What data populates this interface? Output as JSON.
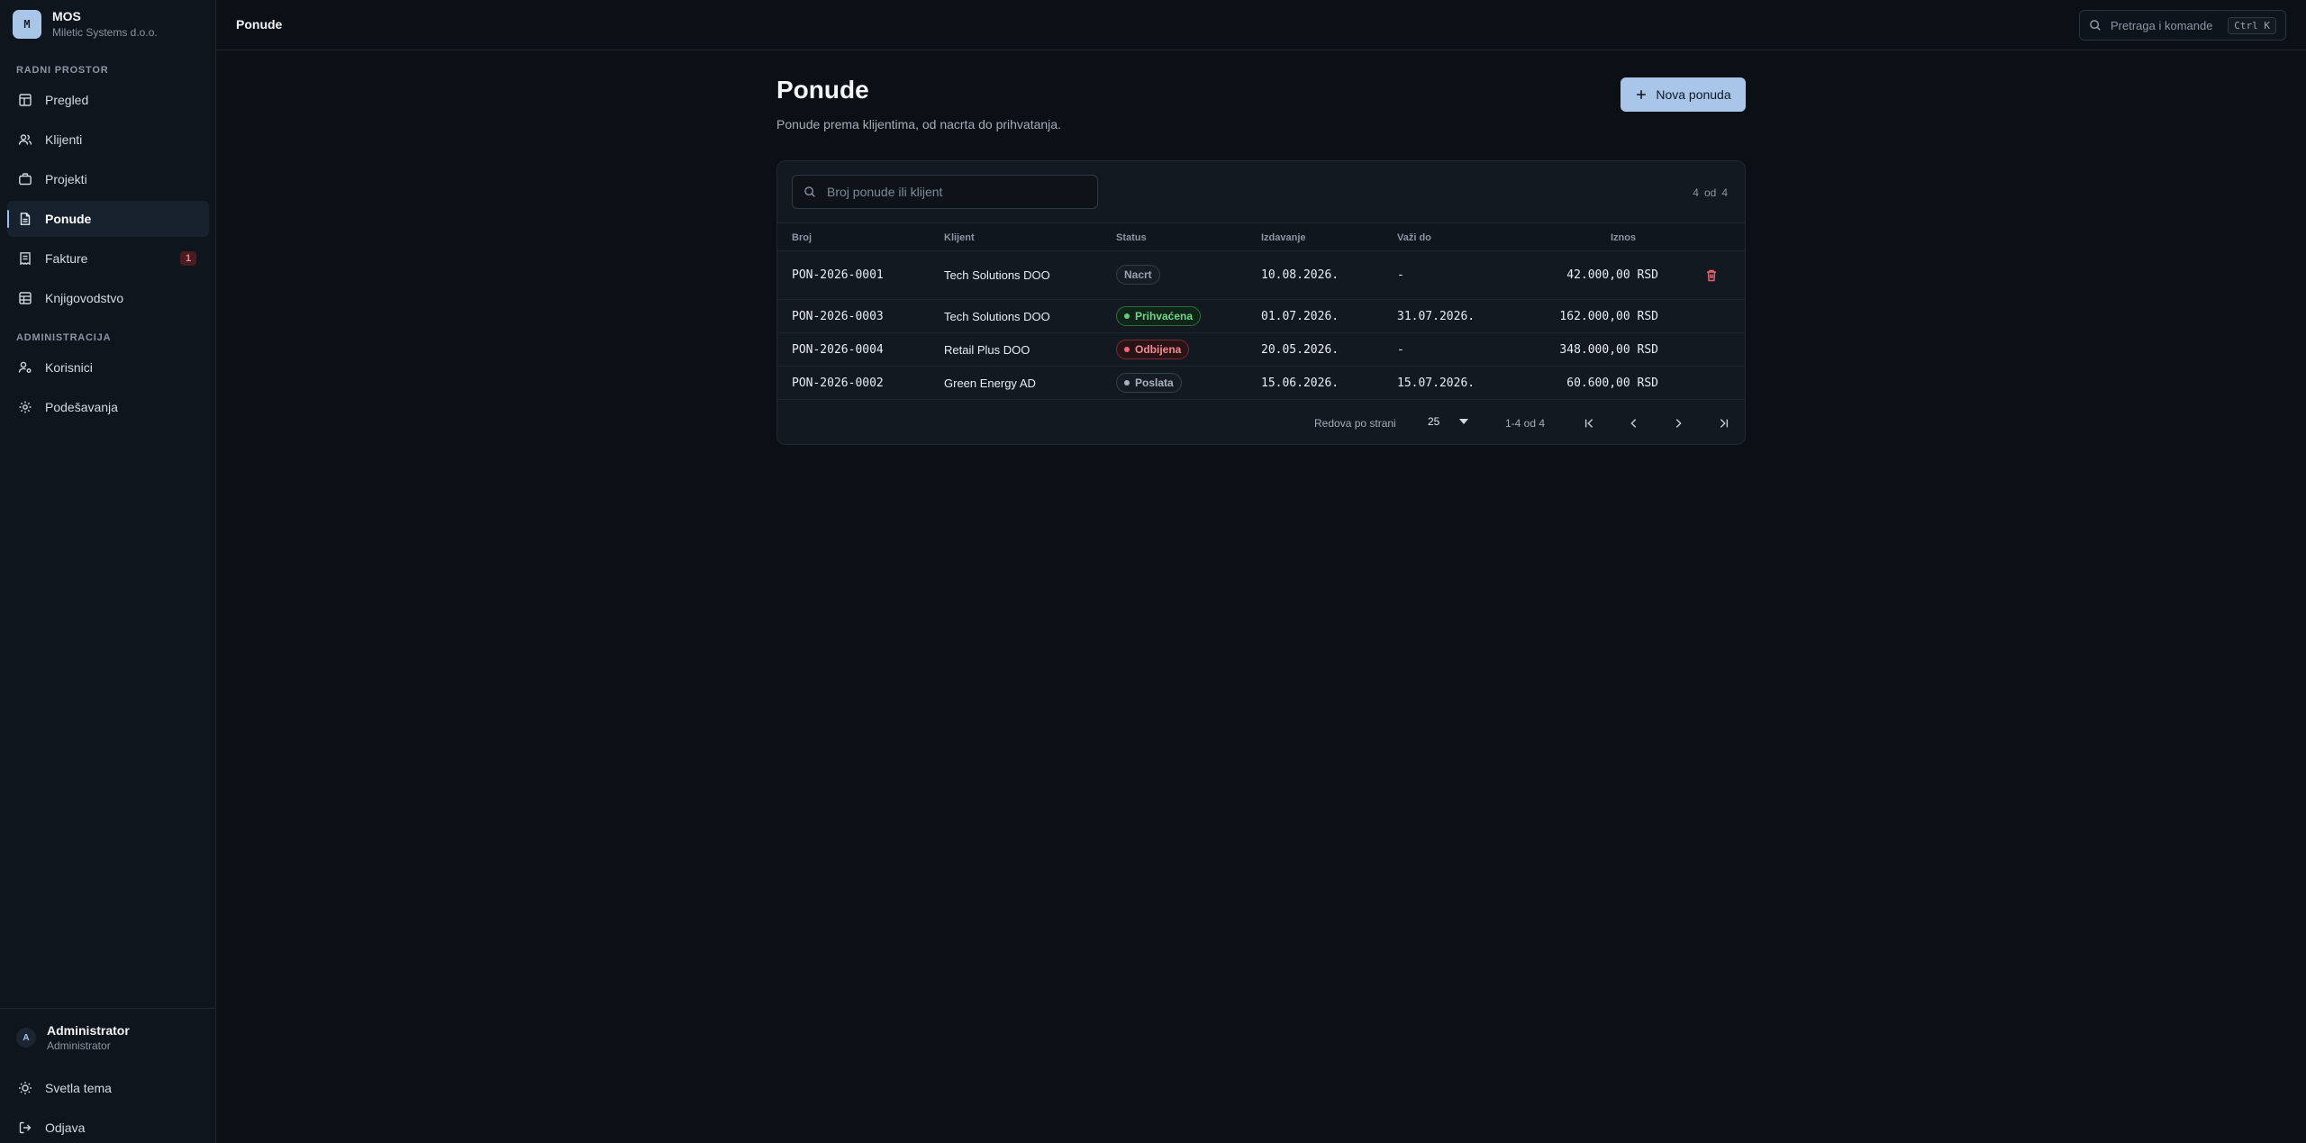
{
  "brand": {
    "initial": "M",
    "name": "MOS",
    "company": "Miletic Systems d.o.o."
  },
  "sidebar": {
    "workspace_label": "RADNI PROSTOR",
    "admin_label": "ADMINISTRACIJA",
    "items": [
      {
        "label": "Pregled",
        "icon": "layout-icon"
      },
      {
        "label": "Klijenti",
        "icon": "users-icon"
      },
      {
        "label": "Projekti",
        "icon": "briefcase-icon"
      },
      {
        "label": "Ponude",
        "icon": "file-icon",
        "active": true
      },
      {
        "label": "Fakture",
        "icon": "receipt-icon",
        "badge": "1"
      },
      {
        "label": "Knjigovodstvo",
        "icon": "table-icon"
      }
    ],
    "admin_items": [
      {
        "label": "Korisnici",
        "icon": "user-cog-icon"
      },
      {
        "label": "Podešavanja",
        "icon": "gear-icon"
      }
    ],
    "user": {
      "initial": "A",
      "name": "Administrator",
      "role": "Administrator"
    },
    "theme_label": "Svetla tema",
    "logout_label": "Odjava"
  },
  "topbar": {
    "title": "Ponude",
    "search_placeholder": "Pretraga i komande",
    "shortcut": "Ctrl K"
  },
  "page": {
    "title": "Ponude",
    "subtitle": "Ponude prema klijentima, od nacrta do prihvatanja.",
    "new_button": "Nova ponuda"
  },
  "table": {
    "search_placeholder": "Broj ponude ili klijent",
    "count": {
      "shown": "4",
      "sep": "od",
      "total": "4"
    },
    "columns": {
      "number": "Broj",
      "client": "Klijent",
      "status": "Status",
      "issued": "Izdavanje",
      "valid": "Važi do",
      "amount": "Iznos"
    },
    "rows": [
      {
        "number": "PON-2026-0001",
        "client": "Tech Solutions DOO",
        "status": "Nacrt",
        "issued": "10.08.2026.",
        "valid": "-",
        "amount": "42.000,00 RSD"
      },
      {
        "number": "PON-2026-0003",
        "client": "Tech Solutions DOO",
        "status": "Prihvaćena",
        "issued": "01.07.2026.",
        "valid": "31.07.2026.",
        "amount": "162.000,00 RSD"
      },
      {
        "number": "PON-2026-0004",
        "client": "Retail Plus DOO",
        "status": "Odbijena",
        "issued": "20.05.2026.",
        "valid": "-",
        "amount": "348.000,00 RSD"
      },
      {
        "number": "PON-2026-0002",
        "client": "Green Energy AD",
        "status": "Poslata",
        "issued": "15.06.2026.",
        "valid": "15.07.2026.",
        "amount": "60.600,00 RSD"
      }
    ],
    "pagination": {
      "rows_label": "Redova po strani",
      "page_size": "25",
      "range": "1-4 od 4"
    }
  },
  "colors": {
    "accent": "#a9c6e8",
    "background": "#0b1016",
    "danger": "#f06a72",
    "success": "#5ecb7d"
  }
}
